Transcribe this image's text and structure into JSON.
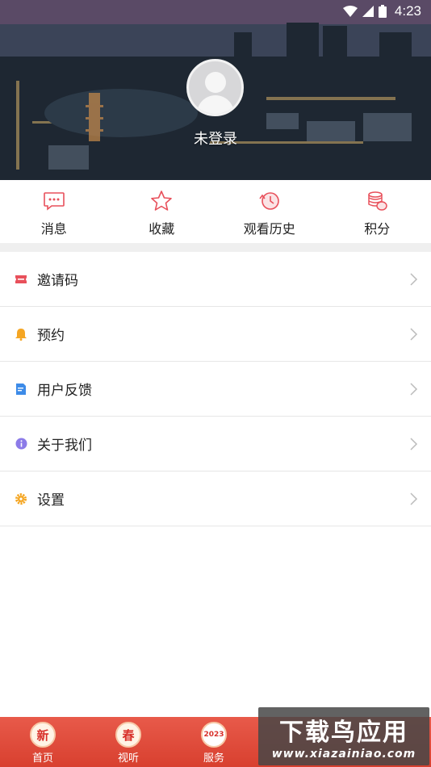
{
  "status_bar": {
    "time": "4:23"
  },
  "profile": {
    "login_status": "未登录"
  },
  "quick_actions": [
    {
      "label": "消息",
      "icon": "message-icon"
    },
    {
      "label": "收藏",
      "icon": "star-icon"
    },
    {
      "label": "观看历史",
      "icon": "history-icon"
    },
    {
      "label": "积分",
      "icon": "coins-icon"
    }
  ],
  "menu": [
    {
      "label": "邀请码",
      "icon": "ticket-icon",
      "color": "#e8505b"
    },
    {
      "label": "预约",
      "icon": "bell-icon",
      "color": "#f5a623"
    },
    {
      "label": "用户反馈",
      "icon": "feedback-icon",
      "color": "#3d8be8"
    },
    {
      "label": "关于我们",
      "icon": "info-icon",
      "color": "#8c7be8"
    },
    {
      "label": "设置",
      "icon": "gear-icon",
      "color": "#f5a623"
    }
  ],
  "tabbar": [
    {
      "label": "首页",
      "badge": "新"
    },
    {
      "label": "视听",
      "badge": "春"
    },
    {
      "label": "服务",
      "badge": "2023"
    }
  ],
  "watermark": {
    "main": "下载鸟应用",
    "url": "www.xiazainiao.com"
  },
  "colors": {
    "accent": "#e8505b",
    "tabbar": "#d8402f"
  }
}
